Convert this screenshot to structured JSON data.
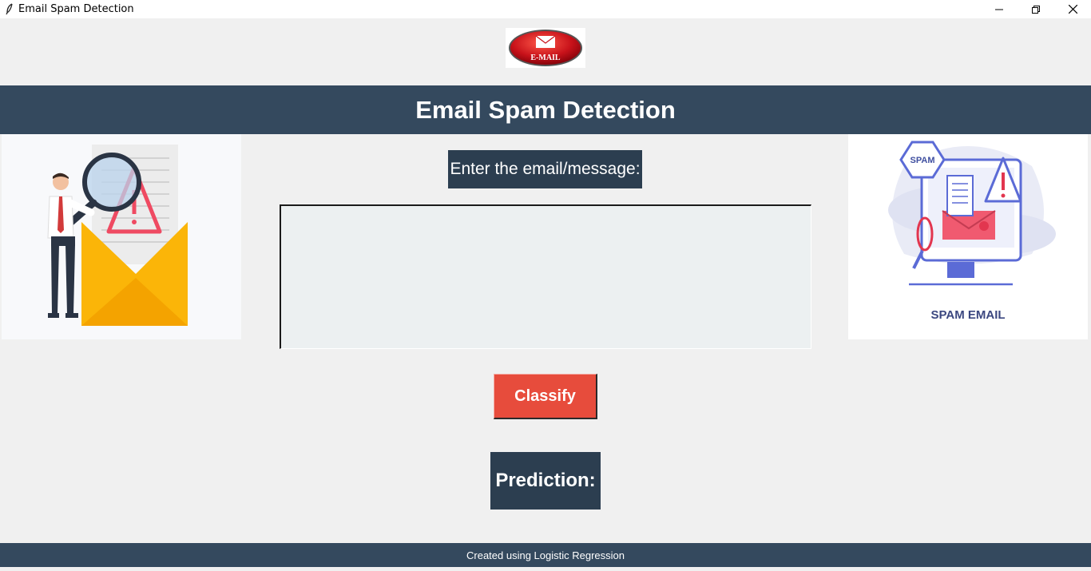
{
  "window": {
    "title": "Email Spam Detection",
    "icon": "feather-icon",
    "controls": [
      "minimize-icon",
      "restore-icon",
      "close-icon"
    ]
  },
  "logo": {
    "text": "E-MAIL",
    "icon": "envelope-icon"
  },
  "header": {
    "title": "Email Spam Detection"
  },
  "left_image": {
    "icon": "magnifier-warning-envelope-illustration"
  },
  "right_image": {
    "caption": "SPAM EMAIL",
    "badge": "SPAM"
  },
  "prompt": {
    "label": "Enter the email/message:"
  },
  "message": {
    "value": ""
  },
  "classify": {
    "label": "Classify"
  },
  "prediction": {
    "label": "Prediction:"
  },
  "footer": {
    "text": "Created using Logistic Regression"
  },
  "colors": {
    "header_bg": "#34495e",
    "label_bg": "#2c3e50",
    "button_bg": "#e74c3c",
    "textarea_bg": "#ecf0f1",
    "window_bg": "#f0f0f0"
  }
}
